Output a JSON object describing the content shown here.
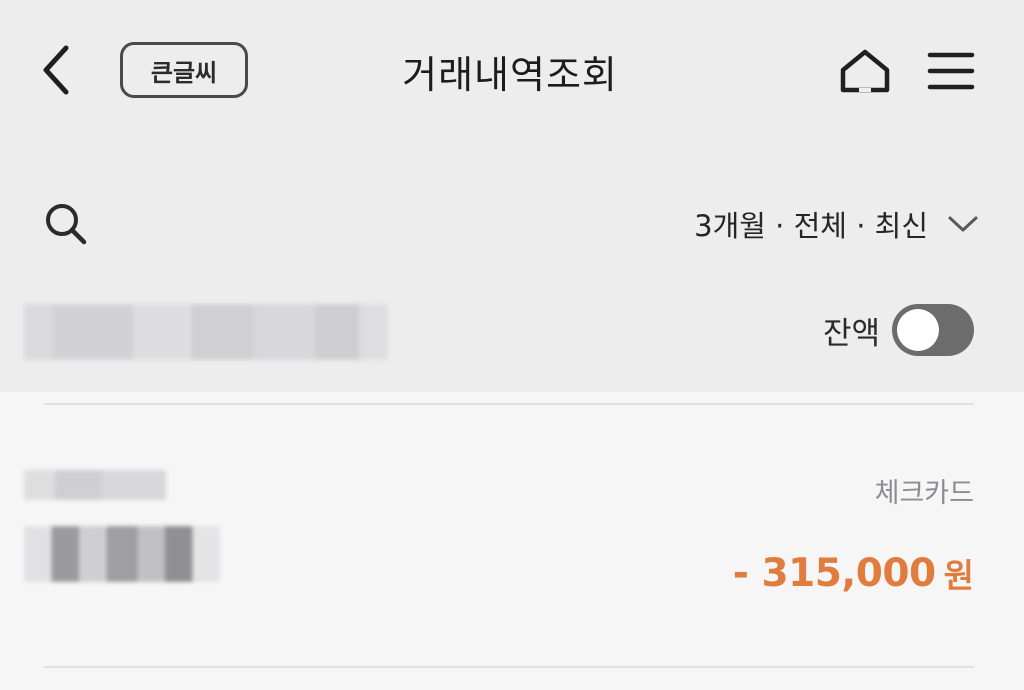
{
  "header": {
    "title": "거래내역조회",
    "big_font_label": "큰글씨",
    "back_icon": "chevron-left-icon",
    "home_icon": "home-icon",
    "menu_icon": "hamburger-menu-icon"
  },
  "filter": {
    "search_icon": "search-icon",
    "summary": "3개월 · 전체 · 최신",
    "dropdown_icon": "chevron-down-icon"
  },
  "account": {
    "balance_label": "잔액",
    "balance_toggle_on": false
  },
  "transactions": [
    {
      "card_type": "체크카드",
      "amount": "- 315,000",
      "currency": "원"
    }
  ],
  "colors": {
    "amount": "#e07d3e",
    "toggle_off": "#6c6c6d",
    "header_bg": "#ededee",
    "list_bg": "#f6f6f7"
  }
}
